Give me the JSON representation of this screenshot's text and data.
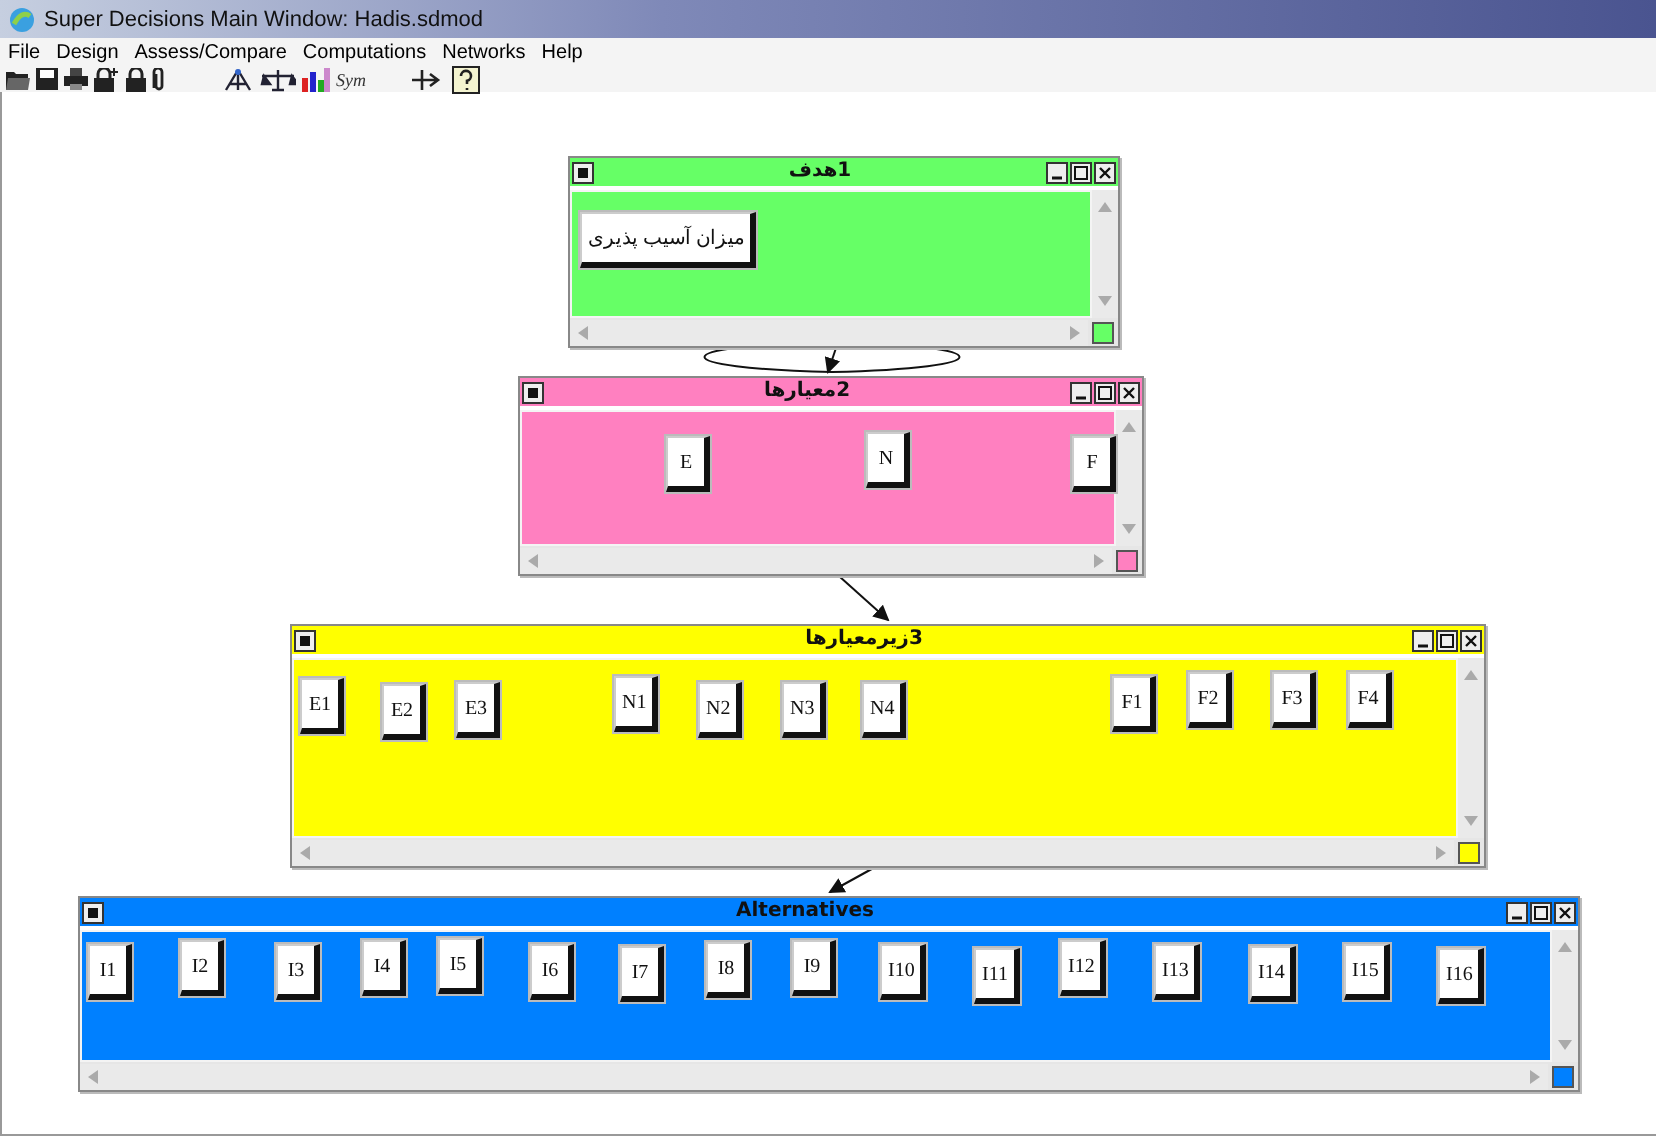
{
  "window": {
    "title": "Super Decisions Main Window: Hadis.sdmod"
  },
  "menu": [
    "File",
    "Design",
    "Assess/Compare",
    "Computations",
    "Networks",
    "Help"
  ],
  "toolbar": {
    "sym_label": "Sym"
  },
  "clusters": [
    {
      "title": "1هدف",
      "color": "#66ff66",
      "nodes": [
        "میزان آسیب پذیری"
      ]
    },
    {
      "title": "2معیارها",
      "color": "#ff80c0",
      "nodes": [
        "E",
        "N",
        "F"
      ]
    },
    {
      "title": "3زیرمعیارها",
      "color": "#ffff00",
      "nodes": [
        "E1",
        "E2",
        "E3",
        "N1",
        "N2",
        "N3",
        "N4",
        "F1",
        "F2",
        "F3",
        "F4"
      ]
    },
    {
      "title": "Alternatives",
      "color": "#0080ff",
      "nodes": [
        "I1",
        "I2",
        "I3",
        "I4",
        "I5",
        "I6",
        "I7",
        "I8",
        "I9",
        "I10",
        "I11",
        "I12",
        "I13",
        "I14",
        "I15",
        "I16"
      ]
    }
  ]
}
